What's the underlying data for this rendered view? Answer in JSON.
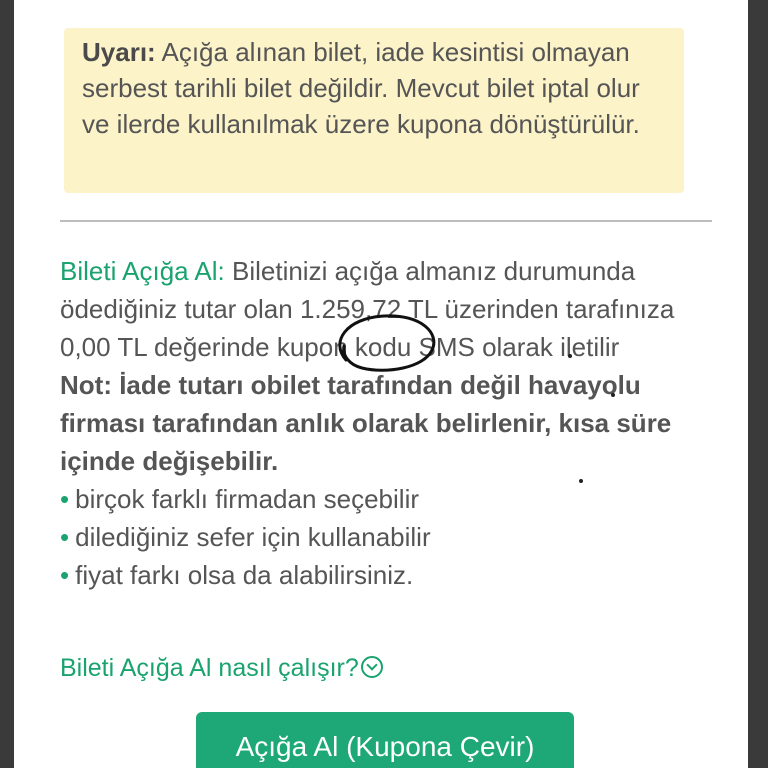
{
  "warning": {
    "label": "Uyarı:",
    "text": " Açığa alınan bilet, iade kesintisi olmayan serbest tarihli bilet değildir. Mevcut bilet iptal olur ve ilerde kullanılmak üzere kupona dönüştürülür."
  },
  "info": {
    "label": "Bileti Açığa Al:",
    "text_before": "  Biletinizi açığa almanız durumunda ödediğiniz tutar olan 1.259,72 TL üzerinden tarafınıza ",
    "amount": "0,00 TL",
    "text_after": " değerinde kupon kodu SMS olarak iletilir"
  },
  "note": "Not: İade tutarı obilet tarafından değil havayolu firması tarafından anlık olarak belirlenir, kısa süre içinde değişebilir.",
  "bullets": [
    "birçok farklı firmadan seçebilir",
    "dilediğiniz sefer için kullanabilir",
    "fiyat farkı olsa da alabilirsiniz."
  ],
  "how_link": "Bileti Açığa Al nasıl çalışır?",
  "button_label": "Açığa Al (Kupona Çevir)",
  "colors": {
    "accent": "#1aa36e",
    "warning_bg": "#fcf3c9"
  }
}
